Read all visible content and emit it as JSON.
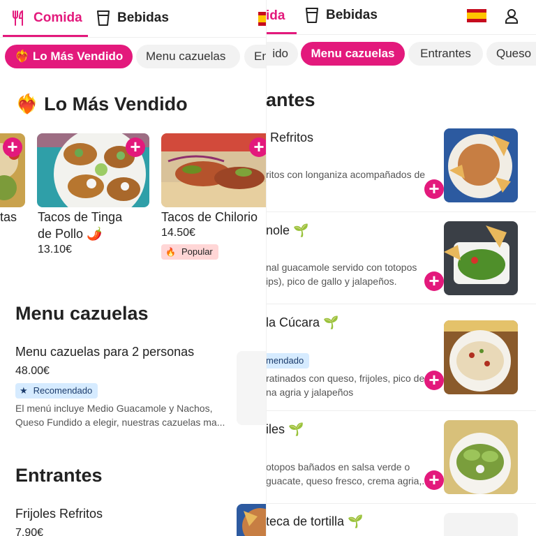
{
  "header": {
    "food_tab": "Comida",
    "drinks_tab": "Bebidas",
    "food_tab_cropped": "ida"
  },
  "categories_left": [
    "Lo Más Vendido",
    "Menu cazuelas",
    "En"
  ],
  "categories_right": [
    "ido",
    "Menu cazuelas",
    "Entrantes",
    "Queso"
  ],
  "best_sellers": {
    "title": "Lo Más Vendido",
    "cropped_name": "tas",
    "items": [
      {
        "name_line1": "Tacos de Tinga",
        "name_line2": "de Pollo",
        "price": "13.10€"
      },
      {
        "name": "Tacos de Chilorio",
        "price": "14.50€",
        "badge": "Popular"
      }
    ]
  },
  "menu_cazuelas": {
    "title": "Menu cazuelas",
    "item": {
      "name": "Menu cazuelas para 2 personas",
      "price": "48.00€",
      "badge": "Recomendado",
      "desc_line1": "El menú incluye Medio Guacamole y Nachos,",
      "desc_line2": "Queso Fundido a elegir, nuestras cazuelas ma..."
    }
  },
  "entrantes_left": {
    "title": "Entrantes",
    "item_name": "Frijoles Refritos",
    "item_price": "7.90€"
  },
  "entrantes_right": {
    "title": "antes",
    "items": [
      {
        "name": "Refritos",
        "desc": "ritos con longaniza acompañados de"
      },
      {
        "name": "nole",
        "desc1": "nal guacamole servido con totopos",
        "desc2": "ips), pico de gallo y jalapeños."
      },
      {
        "name": "la Cúcara",
        "badge": "mendado",
        "desc1": "ratinados con queso, frijoles, pico de",
        "desc2": "na agria y jalapeños"
      },
      {
        "name": "iles",
        "desc1": "otopos bañados en salsa verde o",
        "desc2": "guacate, queso fresco, crema agria,..."
      },
      {
        "name": "teca de tortilla"
      }
    ]
  },
  "colors": {
    "accent": "#e3197c",
    "popular_bg": "#ffd6d6",
    "recommended_bg": "#d6ebff"
  }
}
